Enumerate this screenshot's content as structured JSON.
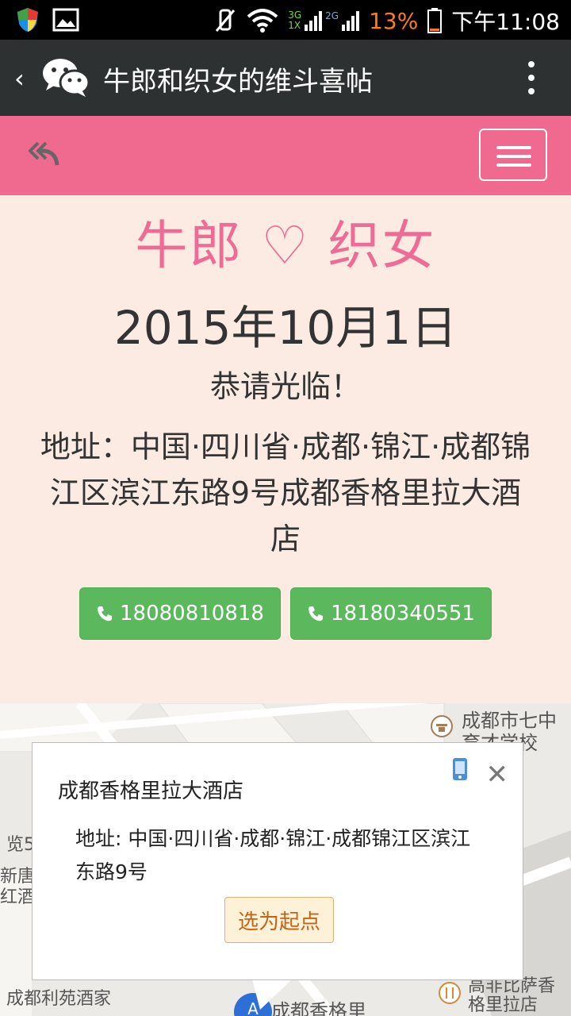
{
  "status_bar": {
    "time": "下午11:08",
    "battery": "13%",
    "net1": "3G",
    "net2": "2G",
    "net3": "1X"
  },
  "header": {
    "title": "牛郎和织女的维斗喜帖"
  },
  "invitation": {
    "couple": "牛郎 ♡ 织女",
    "date": "2015年10月1日",
    "invite_text": "恭请光临！",
    "address": "地址：中国·四川省·成都·锦江·成都锦江区滨江东路9号成都香格里拉大酒店",
    "phones": [
      "18080810818",
      "18180340551"
    ]
  },
  "map": {
    "labels": [
      "成都市七中",
      "育才学校",
      "览5",
      "新唐",
      "红酒",
      "成都利苑酒家",
      "成都香格里",
      "高非比萨香",
      "格里拉店"
    ],
    "popup": {
      "title": "成都香格里拉大酒店",
      "address": "地址: 中国·四川省·成都·锦江·成都锦江区滨江东路9号",
      "start_button": "选为起点"
    }
  },
  "icons": {
    "back": "chevron-left-icon",
    "app": "wechat-icon",
    "more": "more-vertical-icon",
    "reply": "reply-all-icon",
    "menu": "hamburger-icon",
    "phone": "phone-icon",
    "close": "close-icon"
  },
  "colors": {
    "pink_bar": "#f06a90",
    "title_pink": "#ee6b96",
    "button_green": "#5cb85c",
    "background": "#fcebe3",
    "topbar": "#2e3132"
  }
}
